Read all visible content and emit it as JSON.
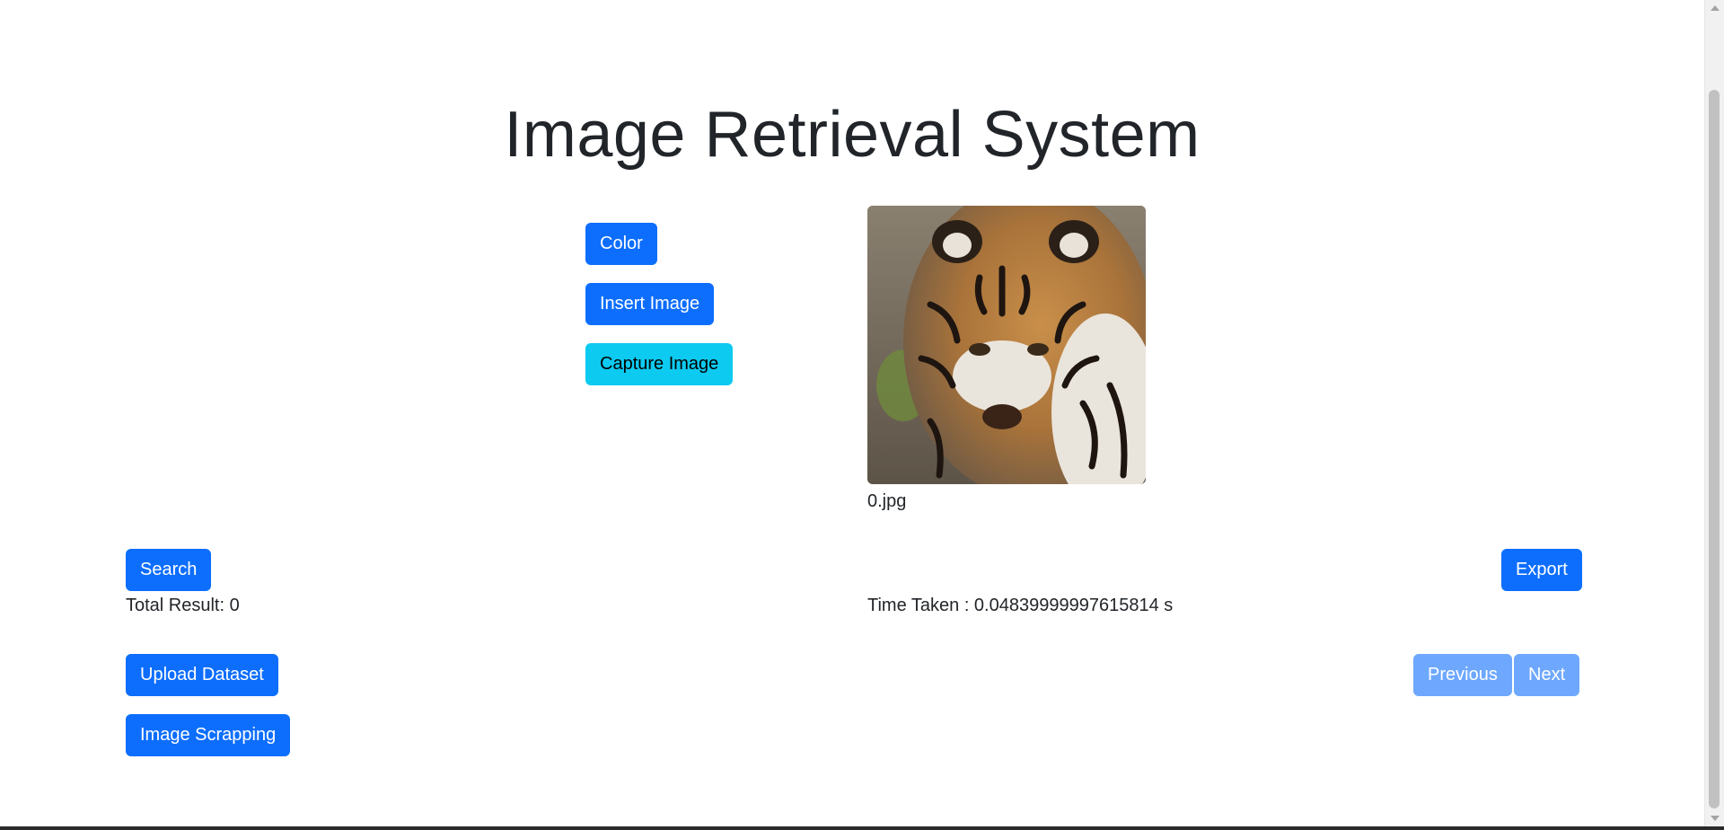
{
  "title": "Image Retrieval System",
  "tools": {
    "color_label": "Color",
    "insert_image_label": "Insert Image",
    "capture_image_label": "Capture Image"
  },
  "preview": {
    "filename": "0.jpg",
    "alt": "tiger"
  },
  "actions": {
    "search_label": "Search",
    "export_label": "Export",
    "total_result_text": "Total Result: 0",
    "time_taken_text": "Time Taken : 0.04839999997615814 s"
  },
  "dataset": {
    "upload_label": "Upload Dataset",
    "scrapping_label": "Image Scrapping"
  },
  "pagination": {
    "previous_label": "Previous",
    "next_label": "Next"
  },
  "colors": {
    "primary": "#0d6efd",
    "info": "#0dcaf0",
    "disabled": "#6ea8fe"
  }
}
